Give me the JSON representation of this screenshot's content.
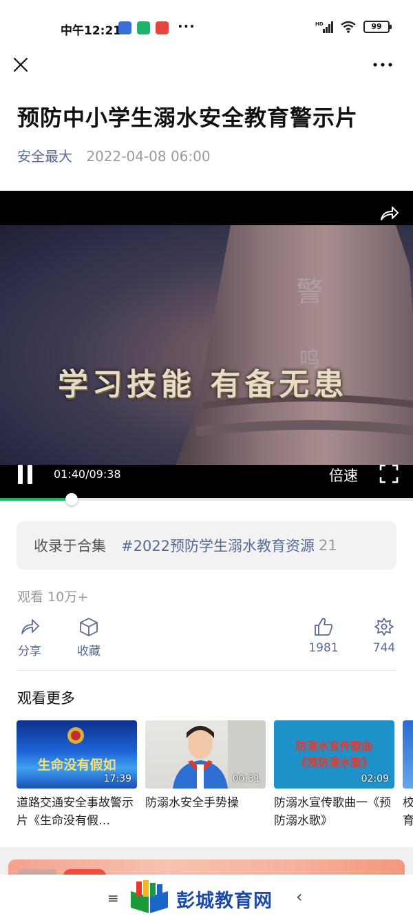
{
  "status": {
    "time": "中午12:21",
    "dots": "···",
    "battery": "99"
  },
  "article": {
    "title": "预防中小学生溺水安全教育警示片",
    "author": "安全最大",
    "date": "2022-04-08 06:00"
  },
  "video": {
    "caption": "学习技能  有备无患",
    "current_time": "01:40",
    "total_time": "09:38",
    "time_display": "01:40/09:38",
    "speed_label": "倍速",
    "progress_fraction": 0.173
  },
  "collection": {
    "label": "收录于合集",
    "tag": "#2022预防学生溺水教育资源",
    "count": "21"
  },
  "views": "观看 10万+",
  "actions": {
    "share_label": "分享",
    "favorite_label": "收藏",
    "like_count": "1981",
    "wow_count": "744"
  },
  "more_section": {
    "title": "观看更多",
    "items": [
      {
        "title": "道路交通安全事故警示片《生命没有假…",
        "duration": "17:39",
        "thumb_text": "生命没有假如"
      },
      {
        "title": "防溺水安全手势操",
        "duration": "00:31",
        "thumb_text": ""
      },
      {
        "title": "防溺水宣传歌曲一《预防溺水歌》",
        "duration": "02:09",
        "thumb_text": "防溺水宣传歌曲《预防溺水歌》"
      },
      {
        "title": "校育",
        "duration": "",
        "thumb_text": ""
      }
    ]
  },
  "bottom": {
    "menu_icon": "≡",
    "back_icon": "‹",
    "logo_text": "彭城教育网"
  },
  "colors": {
    "accent_green": "#07c160",
    "link_blue": "#576b95"
  }
}
